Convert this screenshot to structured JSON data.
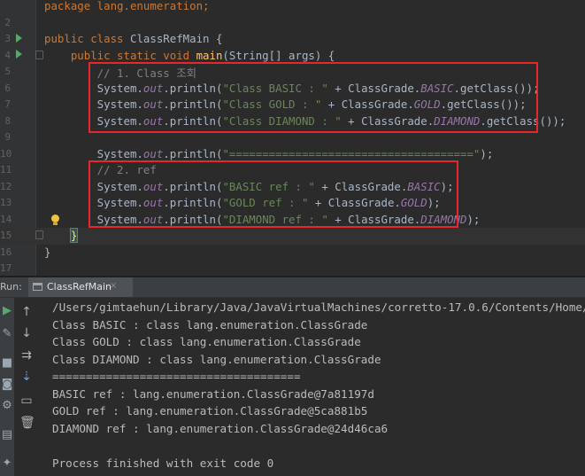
{
  "editor": {
    "lines": [
      {
        "n": "",
        "segs": [
          {
            "t": "package lang.enumeration;",
            "c": "k"
          }
        ]
      },
      {
        "n": "2",
        "segs": []
      },
      {
        "n": "3",
        "segs": [
          {
            "t": "public class ",
            "c": "k"
          },
          {
            "t": "ClassRefMain {",
            "c": ""
          }
        ]
      },
      {
        "n": "4",
        "segs": [
          {
            "t": "    public static void ",
            "c": "k"
          },
          {
            "t": "main",
            "c": "f"
          },
          {
            "t": "(String[] args) {",
            "c": ""
          }
        ]
      },
      {
        "n": "5",
        "segs": [
          {
            "t": "        // 1. Class 조회",
            "c": "c"
          }
        ]
      },
      {
        "n": "6",
        "segs": [
          {
            "t": "        System.",
            "c": ""
          },
          {
            "t": "out",
            "c": "o"
          },
          {
            "t": ".println(",
            "c": ""
          },
          {
            "t": "\"Class BASIC : \"",
            "c": "s"
          },
          {
            "t": " + ClassGrade.",
            "c": ""
          },
          {
            "t": "BASIC",
            "c": "o"
          },
          {
            "t": ".getClass());",
            "c": ""
          }
        ]
      },
      {
        "n": "7",
        "segs": [
          {
            "t": "        System.",
            "c": ""
          },
          {
            "t": "out",
            "c": "o"
          },
          {
            "t": ".println(",
            "c": ""
          },
          {
            "t": "\"Class GOLD : \"",
            "c": "s"
          },
          {
            "t": " + ClassGrade.",
            "c": ""
          },
          {
            "t": "GOLD",
            "c": "o"
          },
          {
            "t": ".getClass());",
            "c": ""
          }
        ]
      },
      {
        "n": "8",
        "segs": [
          {
            "t": "        System.",
            "c": ""
          },
          {
            "t": "out",
            "c": "o"
          },
          {
            "t": ".println(",
            "c": ""
          },
          {
            "t": "\"Class DIAMOND : \"",
            "c": "s"
          },
          {
            "t": " + ClassGrade.",
            "c": ""
          },
          {
            "t": "DIAMOND",
            "c": "o"
          },
          {
            "t": ".getClass());",
            "c": ""
          }
        ]
      },
      {
        "n": "9",
        "segs": []
      },
      {
        "n": "10",
        "segs": [
          {
            "t": "        System.",
            "c": ""
          },
          {
            "t": "out",
            "c": "o"
          },
          {
            "t": ".println(",
            "c": ""
          },
          {
            "t": "\"=====================================\"",
            "c": "s"
          },
          {
            "t": ");",
            "c": ""
          }
        ]
      },
      {
        "n": "11",
        "segs": [
          {
            "t": "        // 2. ref",
            "c": "c"
          }
        ]
      },
      {
        "n": "12",
        "segs": [
          {
            "t": "        System.",
            "c": ""
          },
          {
            "t": "out",
            "c": "o"
          },
          {
            "t": ".println(",
            "c": ""
          },
          {
            "t": "\"BASIC ref : \"",
            "c": "s"
          },
          {
            "t": " + ClassGrade.",
            "c": ""
          },
          {
            "t": "BASIC",
            "c": "o"
          },
          {
            "t": ");",
            "c": ""
          }
        ]
      },
      {
        "n": "13",
        "segs": [
          {
            "t": "        System.",
            "c": ""
          },
          {
            "t": "out",
            "c": "o"
          },
          {
            "t": ".println(",
            "c": ""
          },
          {
            "t": "\"GOLD ref : \"",
            "c": "s"
          },
          {
            "t": " + ClassGrade.",
            "c": ""
          },
          {
            "t": "GOLD",
            "c": "o"
          },
          {
            "t": ");",
            "c": ""
          }
        ]
      },
      {
        "n": "14",
        "segs": [
          {
            "t": "        System.",
            "c": ""
          },
          {
            "t": "out",
            "c": "o"
          },
          {
            "t": ".println(",
            "c": ""
          },
          {
            "t": "\"DIAMOND ref : \"",
            "c": "s"
          },
          {
            "t": " + ClassGrade.",
            "c": ""
          },
          {
            "t": "DIAMOND",
            "c": "o"
          },
          {
            "t": ");",
            "c": ""
          }
        ]
      },
      {
        "n": "15",
        "segs": [
          {
            "t": "    ",
            "c": ""
          },
          {
            "t": "}",
            "c": "brace"
          }
        ]
      },
      {
        "n": "16",
        "segs": [
          {
            "t": "}",
            "c": ""
          }
        ]
      },
      {
        "n": "17",
        "segs": []
      }
    ]
  },
  "run_panel": {
    "title": "Run:",
    "tab_label": "ClassRefMain",
    "tab_close": "×"
  },
  "console": {
    "lines": [
      "/Users/gimtaehun/Library/Java/JavaVirtualMachines/corretto-17.0.6/Contents/Home/",
      "Class BASIC : class lang.enumeration.ClassGrade",
      "Class GOLD : class lang.enumeration.ClassGrade",
      "Class DIAMOND : class lang.enumeration.ClassGrade",
      "=====================================",
      "BASIC ref : lang.enumeration.ClassGrade@7a81197d",
      "GOLD ref : lang.enumeration.ClassGrade@5ca881b5",
      "DIAMOND ref : lang.enumeration.ClassGrade@24d46ca6",
      "",
      "Process finished with exit code 0"
    ]
  },
  "icons": {
    "run": "run-icon",
    "wrench": "wrench-icon",
    "stop": "stop-icon",
    "camera": "camera-icon",
    "settings": "settings-icon",
    "layout": "layout-icon",
    "pin": "pin-icon",
    "up": "up-arrow-icon",
    "down": "down-arrow-icon",
    "soft_wrap": "soft-wrap-icon",
    "scroll_end": "scroll-to-end-icon",
    "print": "print-icon",
    "trash": "trash-icon"
  },
  "colors": {
    "highlight_box": "#e8262b",
    "background": "#2b2b2b"
  }
}
